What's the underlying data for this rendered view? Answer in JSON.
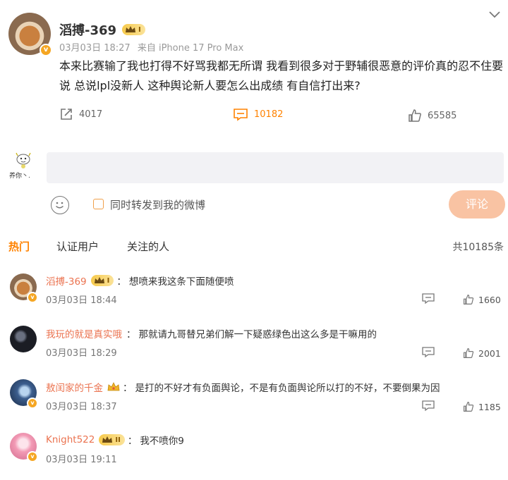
{
  "post": {
    "username": "滔搏-369",
    "level": "I",
    "date": "03月03日 18:27",
    "source": "来自 iPhone 17 Pro Max",
    "text": "本来比赛输了我也打得不好骂我都无所谓 我看到很多对于野辅很恶意的评价真的忍不住要说 总说lpl没新人 这种舆论新人要怎么出成绩 有自信打出来?",
    "reposts": "4017",
    "comments": "10182",
    "likes": "65585"
  },
  "composer": {
    "avatar_caption": "养你丶.",
    "input_value": "",
    "forward_label": "同时转发到我的微博",
    "submit_label": "评论"
  },
  "tabs": {
    "hot": "热门",
    "verified": "认证用户",
    "following": "关注的人",
    "total": "共10185条"
  },
  "comment_list": [
    {
      "name": "滔搏-369",
      "badge": "I",
      "sep": "：",
      "text": "想喷来我这条下面随便喷",
      "time": "03月03日 18:44",
      "likes": "1660"
    },
    {
      "name": "我玩的就是真实哦",
      "badge": "",
      "sep": "：",
      "text": "那就请九哥替兄弟们解一下疑惑绿色出这么多是干嘛用的",
      "time": "03月03日 18:29",
      "likes": "2001"
    },
    {
      "name": "敖闰家的千金",
      "badge": "",
      "sep": "：",
      "text": "是打的不好才有负面舆论，不是有负面舆论所以打的不好，不要倒果为因",
      "time": "03月03日 18:37",
      "likes": "1185"
    },
    {
      "name": "Knight522",
      "badge": "II",
      "sep": "：",
      "text": "我不喷你9",
      "time": "03月03日 19:11",
      "likes": ""
    }
  ],
  "colors": {
    "accent": "#ff8200",
    "name": "#eb7350",
    "submit_bg": "#f9c3a3",
    "input_bg": "#f2f2f5"
  },
  "icons": [
    "chevron-down-icon",
    "repost-icon",
    "comment-icon",
    "like-icon",
    "emoji-icon",
    "checkbox-icon",
    "reply-icon",
    "crown-icon",
    "verified-icon"
  ]
}
